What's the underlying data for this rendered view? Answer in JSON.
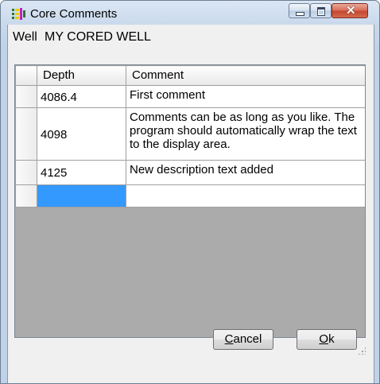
{
  "window": {
    "title": "Core Comments",
    "controls": {
      "minimize": "minimize",
      "maximize": "maximize",
      "close": "close"
    }
  },
  "well": {
    "label": "Well",
    "value": "MY CORED WELL"
  },
  "grid": {
    "columns": [
      "Depth",
      "Comment"
    ],
    "rows": [
      {
        "depth": "4086.4",
        "comment": "First comment"
      },
      {
        "depth": "4098",
        "comment": "Comments can be as long as you like. The program should automatically wrap the text to the display area."
      },
      {
        "depth": "4125",
        "comment": "New description text added"
      },
      {
        "depth": "",
        "comment": ""
      }
    ]
  },
  "buttons": {
    "cancel_prefix": "C",
    "cancel_rest": "ancel",
    "ok_prefix": "O",
    "ok_rest": "k"
  },
  "colors": {
    "selection": "#3399ff",
    "empty_area": "#ababab",
    "close_button": "#c54731"
  }
}
